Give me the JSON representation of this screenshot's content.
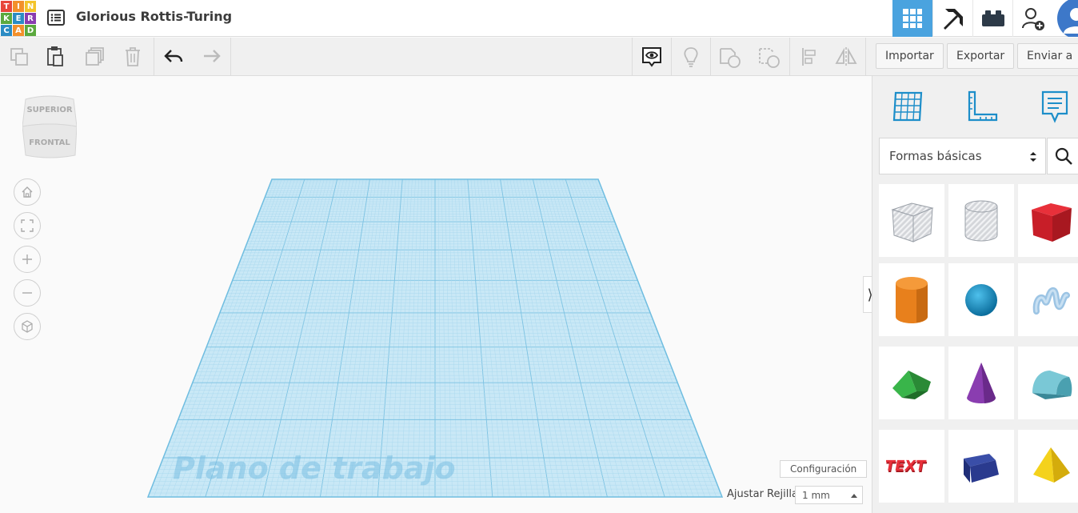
{
  "app": {
    "logo_letters": [
      "T",
      "I",
      "N",
      "K",
      "E",
      "R",
      "C",
      "A",
      "D"
    ],
    "logo_colors": [
      "#e8473b",
      "#f3902b",
      "#f3c42b",
      "#5ba93e",
      "#2b8cc4",
      "#8a3db0",
      "#2b8cc4",
      "#f3902b",
      "#5ba93e"
    ],
    "design_title": "Glorious Rottis-Turing",
    "accent": "#4aa3df"
  },
  "header": {
    "icons": [
      "grid-view-icon",
      "pickaxe-icon",
      "brick-icon",
      "add-user-icon",
      "user-avatar"
    ]
  },
  "toolbar": {
    "import_label": "Importar",
    "export_label": "Exportar",
    "send_label": "Enviar a"
  },
  "viewcube": {
    "top_label": "SUPERIOR",
    "front_label": "FRONTAL"
  },
  "workplane": {
    "label": "Plano de trabajo",
    "config_label": "Configuración",
    "snap_label": "Ajustar Rejilla",
    "snap_value": "1 mm"
  },
  "panel": {
    "tabs": [
      "workplane-icon",
      "ruler-icon",
      "notes-icon"
    ],
    "category": "Formas básicas",
    "shapes": [
      "box-hole",
      "cylinder-hole",
      "box",
      "cylinder",
      "sphere",
      "scribble",
      "roof",
      "cone",
      "round-roof",
      "text",
      "wedge",
      "pyramid"
    ]
  }
}
